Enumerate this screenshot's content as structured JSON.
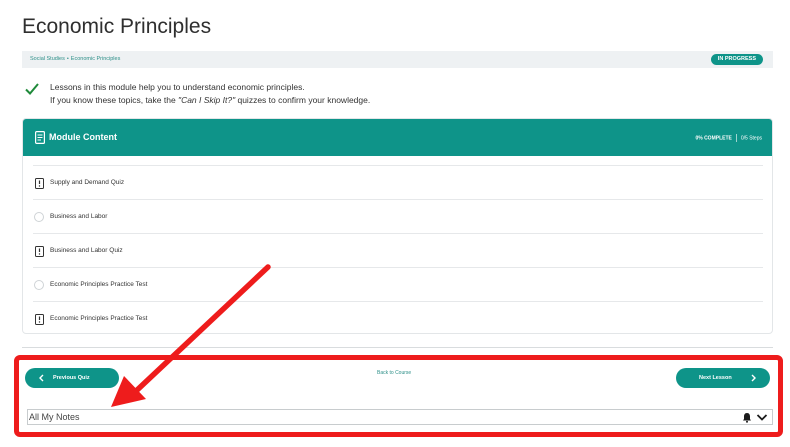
{
  "page": {
    "title": "Economic Principles"
  },
  "breadcrumb": {
    "items": [
      "Social Studies",
      "Economic Principles"
    ],
    "separator": "•"
  },
  "status": {
    "label": "IN PROGRESS"
  },
  "intro": {
    "line1": "Lessons in this module help you to understand economic principles.",
    "line2_before": "If you know these topics, take the ",
    "line2_emphasis": "\"Can I Skip It?\"",
    "line2_after": " quizzes to confirm your knowledge."
  },
  "module": {
    "title": "Module Content",
    "progress_percent": "0% COMPLETE",
    "steps": "0/5 Steps",
    "lessons": [
      {
        "label": "Supply and Demand Quiz",
        "icon": "quiz-icon"
      },
      {
        "label": "Business and Labor",
        "icon": "lesson-circle-icon"
      },
      {
        "label": "Business and Labor Quiz",
        "icon": "quiz-icon"
      },
      {
        "label": "Economic Principles Practice Test",
        "icon": "lesson-circle-icon"
      },
      {
        "label": "Economic Principles Practice Test",
        "icon": "quiz-icon"
      }
    ]
  },
  "navigation": {
    "previous_label": "Previous Quiz",
    "back_label": "Back to Course",
    "next_label": "Next Lesson"
  },
  "notes": {
    "label": "All My Notes"
  },
  "colors": {
    "accent": "#0e9489",
    "highlight": "#ee1c1c",
    "check": "#1f8a3a"
  }
}
